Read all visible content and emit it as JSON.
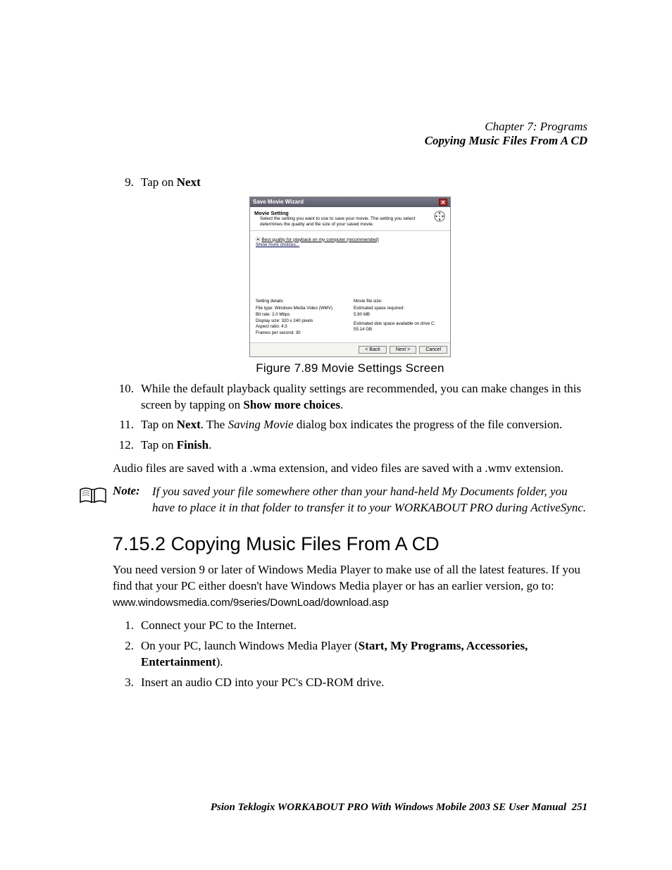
{
  "header": {
    "chapter": "Chapter 7: Programs",
    "section_title": "Copying Music Files From A CD"
  },
  "list_a": {
    "items": [
      {
        "num": "9.",
        "pre": "Tap on ",
        "bold": "Next",
        "post": ""
      }
    ]
  },
  "wizard": {
    "title": "Save Movie Wizard",
    "heading": "Movie Setting",
    "heading_desc": "Select the setting you want to use to save your movie. The setting you select determines the quality and file size of your saved movie.",
    "radio_label": "Best quality for playback on my computer (recommended)",
    "show_more": "Show more choices...",
    "settings_heading": "Setting details",
    "settings": {
      "line1": "File type: Windows Media Video (WMV)",
      "line2": "Bit rate: 2.0 Mbps",
      "line3": "Display size: 320 x 240 pixels",
      "line4": "Aspect ratio: 4:3",
      "line5": "Frames per second: 30"
    },
    "size_heading": "Movie file size:",
    "size": {
      "line1": "Estimated space required:",
      "line2": "5.90 MB",
      "line3": "Estimated disk space available on drive C:",
      "line4": "55.14 GB"
    },
    "buttons": {
      "back": "< Back",
      "next": "Next >",
      "cancel": "Cancel"
    }
  },
  "figure_caption": "Figure 7.89 Movie Settings Screen",
  "list_b": {
    "items": [
      {
        "num": "10.",
        "segments": [
          {
            "t": "While the default playback quality settings are recommended, you can make changes in this screen by tapping on "
          },
          {
            "t": "Show more choices",
            "bold": true
          },
          {
            "t": "."
          }
        ]
      },
      {
        "num": "11.",
        "segments": [
          {
            "t": "Tap on "
          },
          {
            "t": "Next",
            "bold": true
          },
          {
            "t": ". The "
          },
          {
            "t": "Saving Movie",
            "italic": true
          },
          {
            "t": " dialog box indicates the progress of the file conversion."
          }
        ]
      },
      {
        "num": "12.",
        "segments": [
          {
            "t": "Tap on "
          },
          {
            "t": "Finish",
            "bold": true
          },
          {
            "t": "."
          }
        ]
      }
    ]
  },
  "para_audio": "Audio files are saved with a .wma extension, and video files are saved with a .wmv extension.",
  "note": {
    "label": "Note:",
    "text": "If you saved your file somewhere other than your hand-held My Documents folder, you have to place it in that folder to transfer it to your WORKABOUT PRO during ActiveSync."
  },
  "h2": "7.15.2  Copying Music Files From A CD",
  "para_intro_pre": "You need version 9 or later of Windows Media Player to make use of all the latest features. If you find that your PC either doesn't have Windows Media player or has an earlier version, go to: ",
  "para_intro_url": "www.windowsmedia.com/9series/DownLoad/download.asp",
  "list_c": {
    "items": [
      {
        "num": "1.",
        "segments": [
          {
            "t": "Connect your PC to the Internet."
          }
        ]
      },
      {
        "num": "2.",
        "segments": [
          {
            "t": "On your PC, launch Windows Media Player ("
          },
          {
            "t": "Start, My Programs, Accessories, Entertainment",
            "bold": true
          },
          {
            "t": ")."
          }
        ]
      },
      {
        "num": "3.",
        "segments": [
          {
            "t": "Insert an audio CD into your PC's CD-ROM drive."
          }
        ]
      }
    ]
  },
  "footer": {
    "text": "Psion Teklogix WORKABOUT PRO With Windows Mobile 2003 SE User Manual",
    "page": "251"
  }
}
